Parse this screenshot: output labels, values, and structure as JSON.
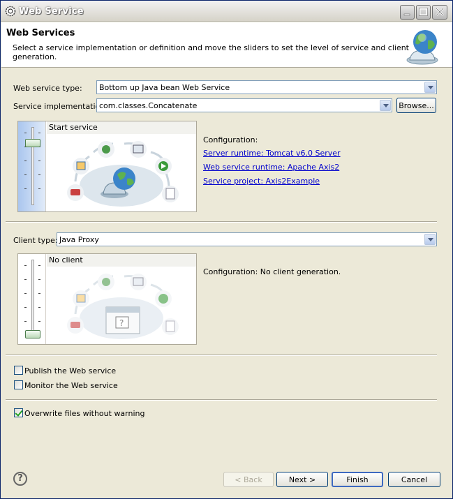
{
  "window": {
    "title": "Web Service"
  },
  "banner": {
    "title": "Web Services",
    "description": "Select a service implementation or definition and move the sliders to set the level of service and client generation."
  },
  "service": {
    "type_label": "Web service type:",
    "type_value": "Bottom up Java bean Web Service",
    "impl_label": "Service implementation:",
    "impl_value": "com.classes.Concatenate",
    "browse_label": "Browse...",
    "slider_level_label": "Start service",
    "configuration_label": "Configuration:",
    "links": {
      "server_runtime": "Server runtime: Tomcat v6.0 Server",
      "ws_runtime": "Web service runtime: Apache Axis2",
      "service_project": "Service project: Axis2Example"
    }
  },
  "client": {
    "type_label": "Client type:",
    "type_value": "Java Proxy",
    "slider_level_label": "No client",
    "configuration_text": "Configuration: No client generation."
  },
  "options": {
    "publish": {
      "label": "Publish the Web service",
      "checked": false
    },
    "monitor": {
      "label": "Monitor the Web service",
      "checked": false
    },
    "overwrite": {
      "label": "Overwrite files without warning",
      "checked": true
    }
  },
  "footer": {
    "help_icon": "?",
    "back": "< Back",
    "next": "Next >",
    "finish": "Finish",
    "cancel": "Cancel"
  },
  "icons": {
    "window": "eclipse-gear-icon",
    "banner": "globe-service-icon",
    "minimize": "minimize-icon",
    "maximize": "maximize-icon",
    "close": "close-icon"
  }
}
